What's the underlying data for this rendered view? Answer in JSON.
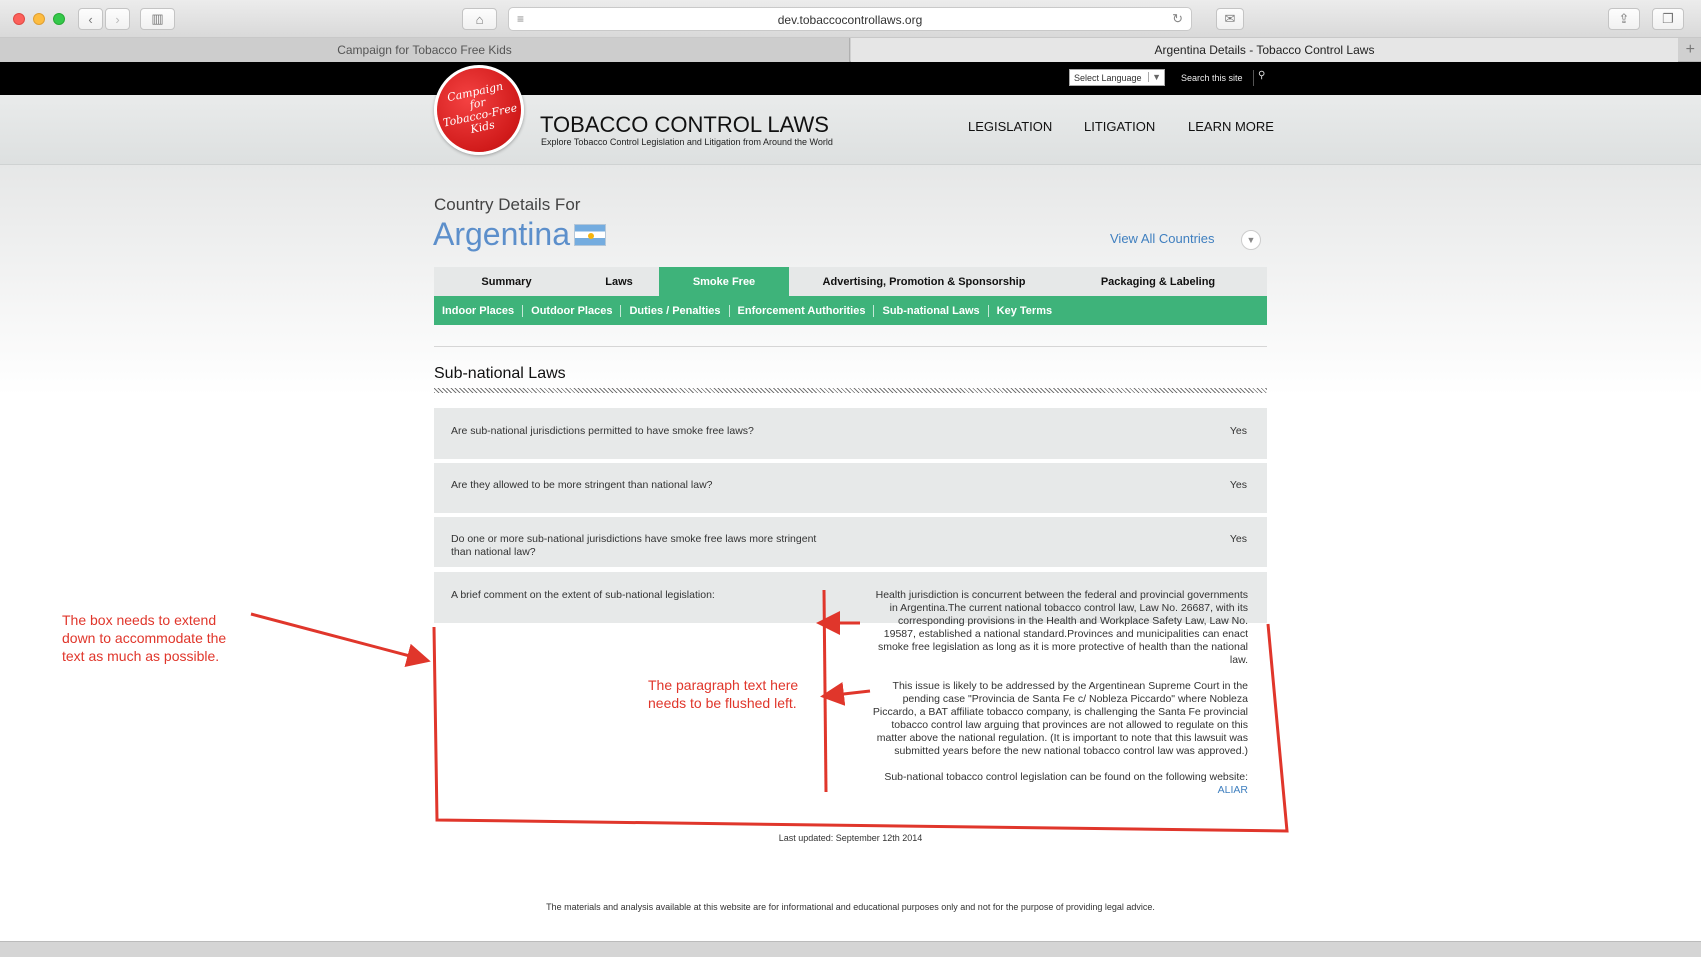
{
  "browser": {
    "url": "dev.tobaccocontrollaws.org",
    "tabs": [
      "Campaign for Tobacco Free Kids",
      "Argentina Details - Tobacco Control Laws"
    ]
  },
  "topbar": {
    "language_select": "Select Language",
    "search_label": "Search this site"
  },
  "header": {
    "logo_text": [
      "Campaign",
      "for",
      "Tobacco-Free",
      "Kids"
    ],
    "title": "TOBACCO CONTROL LAWS",
    "subtitle": "Explore Tobacco Control Legislation and Litigation from Around the World",
    "nav": [
      "LEGISLATION",
      "LITIGATION",
      "LEARN MORE"
    ]
  },
  "country": {
    "label": "Country Details For",
    "name": "Argentina",
    "view_all": "View All Countries"
  },
  "main_tabs": [
    "Summary",
    "Laws",
    "Smoke Free",
    "Advertising, Promotion & Sponsorship",
    "Packaging & Labeling"
  ],
  "active_tab": "Smoke Free",
  "sub_tabs": [
    "Indoor Places",
    "Outdoor Places",
    "Duties / Penalties",
    "Enforcement Authorities",
    "Sub-national Laws",
    "Key Terms"
  ],
  "section": {
    "title": "Sub-national Laws",
    "questions": [
      {
        "q": "Are sub-national jurisdictions permitted to have smoke free laws?",
        "a": "Yes"
      },
      {
        "q": "Are they allowed to be more stringent than national law?",
        "a": "Yes"
      },
      {
        "q_line1": "Do one or more sub-national jurisdictions have smoke free laws more stringent",
        "q_line2": "than national law?",
        "a": "Yes"
      }
    ],
    "comment_label": "A brief comment on the extent of sub-national legislation:",
    "comment_paragraphs": [
      [
        "Health jurisdiction is concurrent between the federal and provincial governments",
        "in Argentina.The current national tobacco control law, Law No. 26687, with its",
        "corresponding provisions in the Health and Workplace Safety Law, Law No.",
        "19587, established a national standard.Provinces and municipalities can enact",
        "smoke free legislation as long as it is more protective of health than the national",
        "law."
      ],
      [
        "This issue is likely to be addressed by the Argentinean Supreme Court in the",
        "pending case \"Provincia de Santa Fe c/ Nobleza Piccardo\" where Nobleza",
        "Piccardo, a BAT affiliate tobacco company, is challenging the Santa Fe provincial",
        "tobacco control law arguing that provinces are not allowed to regulate on this",
        "matter above the national regulation. (It is important to note that this lawsuit was",
        "submitted years before the new national tobacco control law was approved.)"
      ],
      [
        "Sub-national tobacco control legislation can be found on the following website:"
      ]
    ],
    "link": "ALIAR",
    "last_updated": "Last updated: September 12th 2014"
  },
  "footer": "The materials and analysis available at this website are for informational and educational purposes only and not for the purpose of providing legal advice.",
  "annotations": {
    "left": [
      "The box needs to extend",
      "down to accommodate the",
      "text as much as possible."
    ],
    "middle": [
      "The paragraph text here",
      "needs to be flushed left."
    ]
  },
  "colors": {
    "green": "#3eb37a",
    "link_blue": "#3f7fbf",
    "annotation_red": "#e0362b"
  }
}
